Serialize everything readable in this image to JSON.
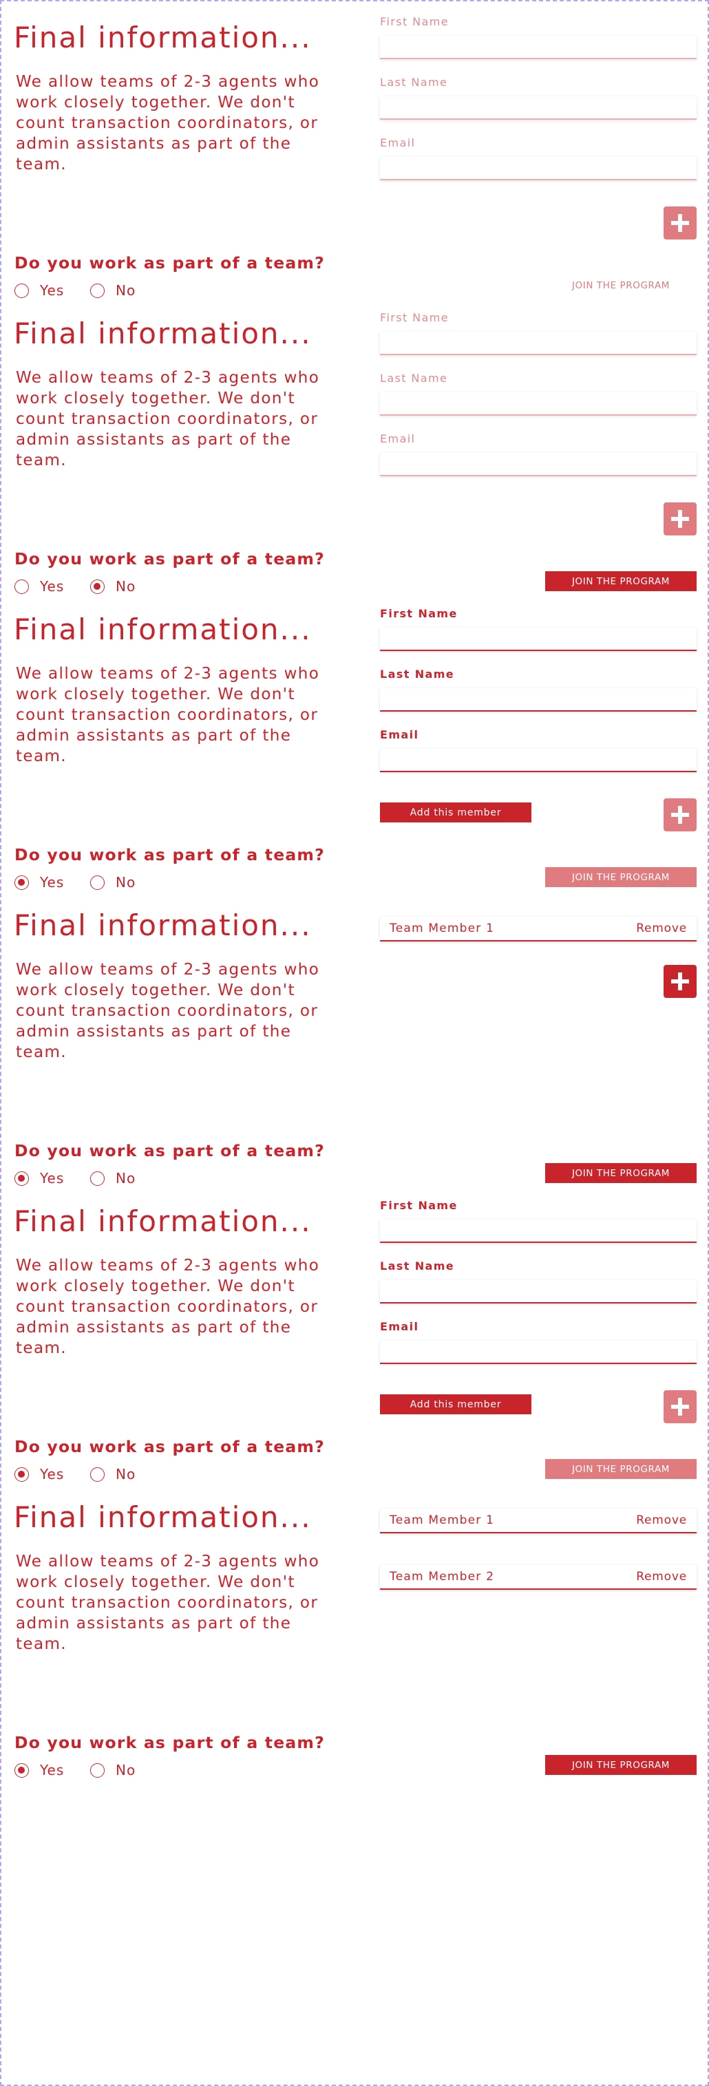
{
  "content": {
    "title": "Final information...",
    "description": "We allow teams of 2-3 agents who work closely together. We don't count transaction coordinators, or admin assistants as part of the team.",
    "question": "Do you work as part of a team?",
    "yes_label": "Yes",
    "no_label": "No",
    "first_name_label": "First Name",
    "last_name_label": "Last Name",
    "email_label": "Email",
    "join_label": "JOIN THE PROGRAM",
    "add_member_label": "Add this member",
    "remove_label": "Remove",
    "member_1": "Team Member 1",
    "member_2": "Team Member 2"
  },
  "states": [
    {
      "selected": "none",
      "fields": "faint",
      "join": "link",
      "plus": "faint"
    },
    {
      "selected": "no",
      "fields": "faint",
      "join": "solid",
      "plus": "faint"
    },
    {
      "selected": "yes",
      "fields": "strong",
      "join": "faint",
      "plus": "faint",
      "add_member": true
    },
    {
      "selected": "yes",
      "members": [
        "Team Member 1"
      ],
      "join": "solid",
      "plus": "solid"
    },
    {
      "selected": "yes",
      "fields": "strong",
      "join": "faint",
      "plus": "faint",
      "add_member": true
    },
    {
      "selected": "yes",
      "members": [
        "Team Member 1",
        "Team Member 2"
      ],
      "join": "solid"
    }
  ],
  "colors": {
    "brand_red": "#c9242b",
    "faint_red": "#e07b80",
    "frame_border": "#b3a6f0"
  },
  "icons": {
    "add": "plus-icon"
  }
}
